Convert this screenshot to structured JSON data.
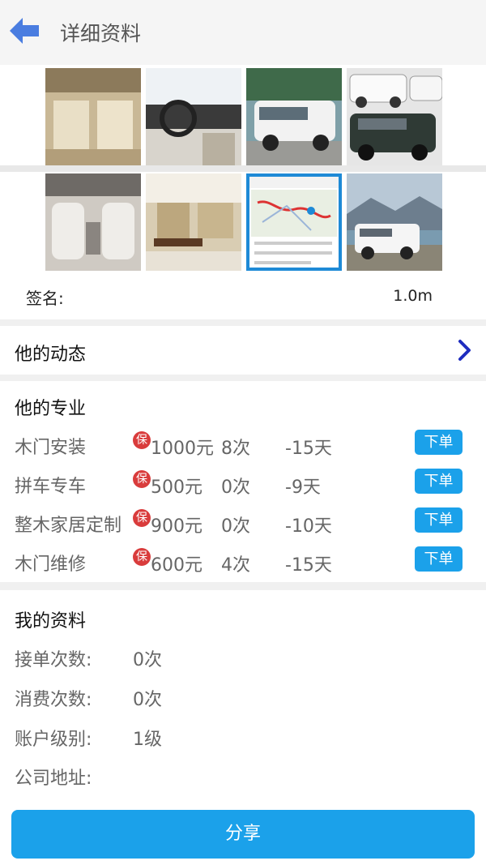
{
  "header": {
    "title": "详细资料",
    "back_icon": "arrow-left-icon"
  },
  "photos": [
    {
      "name": "car-interior-rear-photo"
    },
    {
      "name": "car-dashboard-photo"
    },
    {
      "name": "white-suv-front-photo"
    },
    {
      "name": "two-suvs-photo"
    },
    {
      "name": "van-interior-seats-photo"
    },
    {
      "name": "car-interior-table-photo"
    },
    {
      "name": "route-map-screenshot-photo"
    },
    {
      "name": "white-suv-lake-photo"
    }
  ],
  "profile": {
    "sign_label": "签名:",
    "distance": "1.0m"
  },
  "dynamics": {
    "label": "他的动态",
    "icon": "chevron-right-icon"
  },
  "specialty": {
    "title": "他的专业",
    "bao_label": "保",
    "order_label": "下单",
    "items": [
      {
        "name": "木门安装",
        "price": "1000元",
        "count": "8次",
        "days": "-15天"
      },
      {
        "name": "拼车专车",
        "price": "500元",
        "count": "0次",
        "days": "-9天"
      },
      {
        "name": "整木家居定制",
        "price": "900元",
        "count": "0次",
        "days": "-10天"
      },
      {
        "name": "木门维修",
        "price": "600元",
        "count": "4次",
        "days": "-15天"
      }
    ]
  },
  "my_info": {
    "title": "我的资料",
    "rows": [
      {
        "label": "接单次数:",
        "value": "0次"
      },
      {
        "label": "消费次数:",
        "value": "0次"
      },
      {
        "label": "账户级别:",
        "value": "1级"
      },
      {
        "label": "公司地址:",
        "value": ""
      }
    ]
  },
  "share": {
    "label": "分享"
  },
  "colors": {
    "accent": "#1ba1ea",
    "badge": "#d93c3c",
    "back_arrow": "#4a7de0",
    "chevron": "#1f2dbf"
  }
}
